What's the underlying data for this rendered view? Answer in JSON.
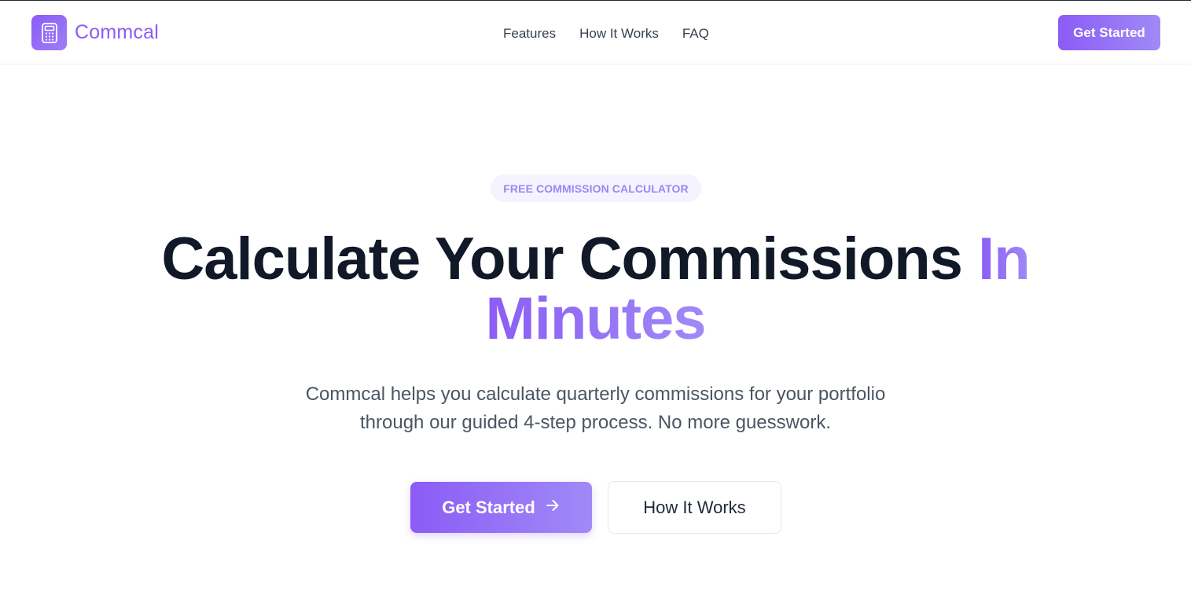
{
  "header": {
    "brand_name": "Commcal",
    "logo_icon": "calculator-icon",
    "nav": [
      {
        "label": "Features"
      },
      {
        "label": "How It Works"
      },
      {
        "label": "FAQ"
      }
    ],
    "cta_label": "Get Started"
  },
  "hero": {
    "badge": "FREE COMMISSION CALCULATOR",
    "title_main": "Calculate Your Commissions ",
    "title_accent_1": "In",
    "title_accent_2": "Minutes",
    "subtitle_line1": "Commcal helps you calculate quarterly commissions for your portfolio",
    "subtitle_line2": "through our guided 4-step process. No more guesswork.",
    "primary_button": "Get Started",
    "primary_button_icon": "arrow-right-icon",
    "secondary_button": "How It Works"
  },
  "colors": {
    "accent": "#8b5cf6",
    "accent_light": "#a08af6",
    "heading": "#111827",
    "body_text": "#4b5563",
    "badge_bg": "#f5f3ff"
  }
}
